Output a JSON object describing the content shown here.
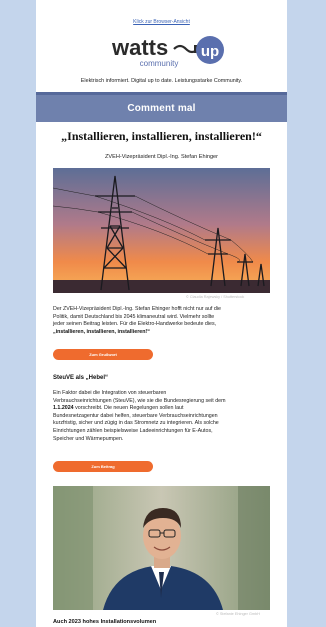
{
  "header": {
    "browser_link": "Klick zur Browser-Ansicht",
    "logo_text_1": "watts",
    "logo_text_2": "community",
    "logo_text_3": "up",
    "tagline": "Elektrisch informiert. Digital up to date. Leistungsstarke Community."
  },
  "banner": {
    "title": "Comment mal"
  },
  "article": {
    "headline": "„Installieren, installieren, installieren!“",
    "subline": "ZVEH-Vizepräsident Dipl.-Ing. Stefan Ehinger",
    "photo1_credit": "© Claudia Rajewsky / Shutterstock",
    "intro_lines": [
      "Der ZVEH-Vizepräsident Dipl.-Ing. Stefan Ehinger hofft nicht nur auf die",
      "Politik, damit Deutschland bis 2045 klimaneutral wird. Vielmehr sollte",
      "jeder seinen Beitrag leisten. Für die Elektro-Handwerke bedeute dies,"
    ],
    "intro_bold": "„installieren, installieren, installieren!“",
    "button1": "Zum Grußwort",
    "section_title": "SteuVE als „Hebel“",
    "body_line_1": "Ein Faktor dabei die Integration von steuerbaren",
    "body_line_2": "Verbrauchseinrichtungen (SteuVE), wie sie die Bundesregierung seit dem",
    "body_date": "1.1.2024",
    "body_line_3_rest": " vorschreibt. Die neuen Regelungen sollen laut",
    "body_lines_rest": [
      "Bundesnetzagentur dabei helfen, steuerbare Verbrauchseinrichtungen",
      "kurzfristig, sicher und zügig in das Stromnetz zu integrieren. Als solche",
      "Einrichtungen zählen beispielsweise Ladeeinrichtungen für E-Autos,",
      "Speicher und Wärmepumpen."
    ],
    "button2": "Zum Beitrag",
    "photo2_credit": "© Stefanie Ehinger GmbH",
    "next_heading": "Auch 2023 hohes Installationsvolumen"
  },
  "colors": {
    "background": "#c4d5ec",
    "banner": "#6f81ad",
    "accent_button": "#ef6b2e",
    "logo_blue": "#5a6fae"
  }
}
